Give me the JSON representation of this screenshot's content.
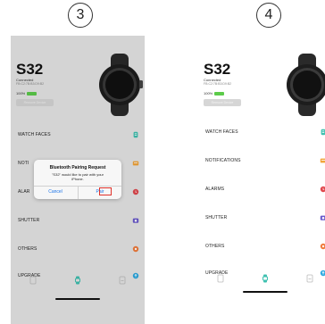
{
  "steps": {
    "left": "3",
    "right": "4"
  },
  "device": {
    "name": "S32",
    "status": "Connected",
    "mac": "FB:C2:7B:B3:D9:B2",
    "battery": "100%",
    "battery_level": 1.0,
    "remove_label": "Remove Device"
  },
  "menu": [
    {
      "label": "WATCH FACES",
      "icon": "watch-face-icon",
      "color": "#3fc1b0"
    },
    {
      "label": "NOTIFICATIONS",
      "icon": "message-icon",
      "color": "#f2a53a"
    },
    {
      "label": "ALARMS",
      "icon": "alarm-icon",
      "color": "#e0474c"
    },
    {
      "label": "SHUTTER",
      "icon": "camera-icon",
      "color": "#6a5acd"
    },
    {
      "label": "OTHERS",
      "icon": "gear-icon",
      "color": "#f07a3a"
    },
    {
      "label": "UPGRADE",
      "icon": "upload-icon",
      "color": "#2aa8e0"
    }
  ],
  "menu_left_visible": [
    "WATCH FACES",
    "NOTI",
    "ALAR",
    "SHUTTER",
    "OTHERS",
    "UPGRADE"
  ],
  "dialog": {
    "title": "Bluetooth Pairing Request",
    "message": "\"S32\" would like to pair with your iPhone.",
    "cancel": "Cancel",
    "pair": "Pair"
  },
  "tabs": [
    {
      "icon": "document-icon",
      "active": false
    },
    {
      "icon": "watch-icon",
      "active": true
    },
    {
      "icon": "profile-icon",
      "active": false
    }
  ],
  "colors": {
    "accent": "#3fc1b0",
    "battery": "#5ccb4a",
    "highlight": "#e0322b",
    "link": "#1a73e8"
  }
}
